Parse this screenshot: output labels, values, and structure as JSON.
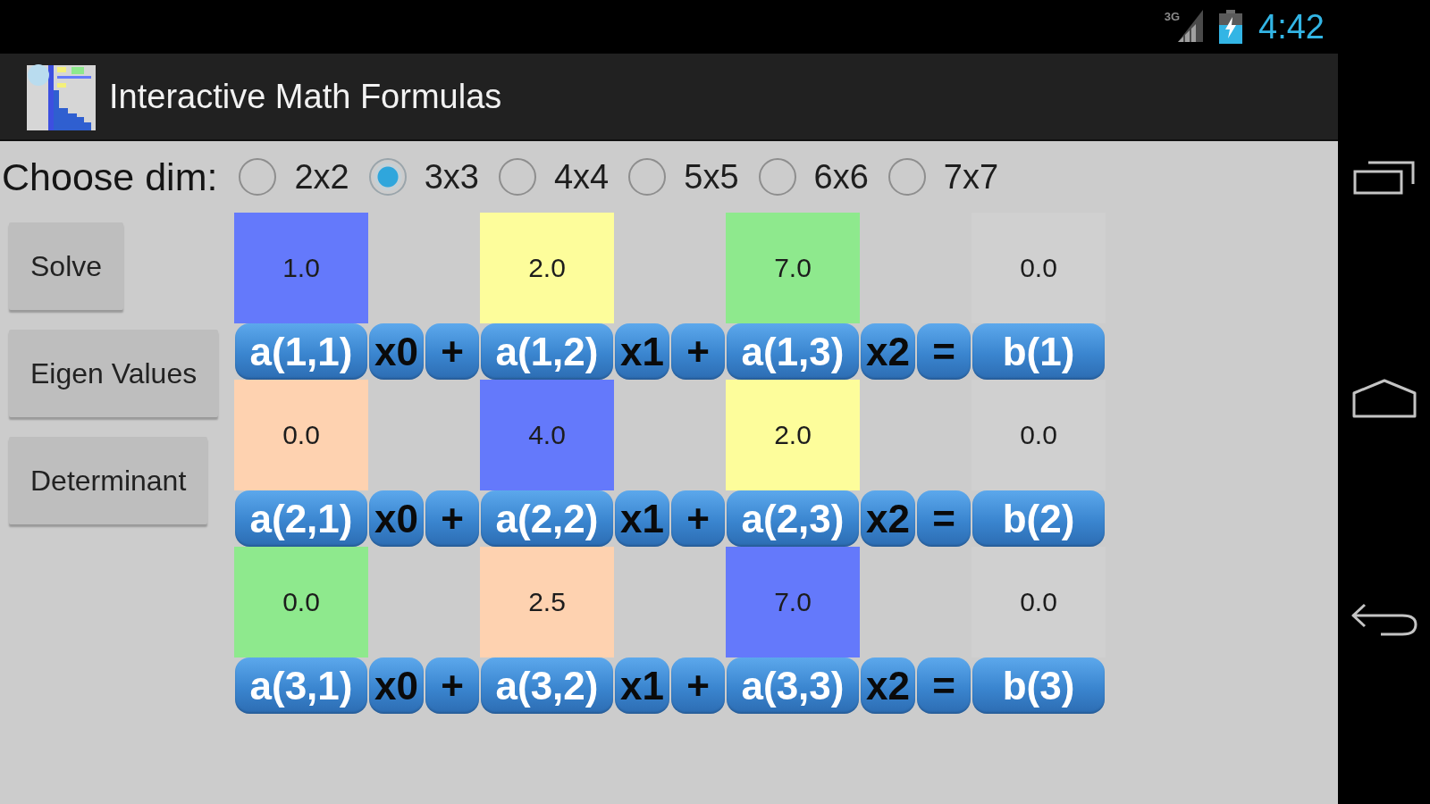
{
  "status_bar": {
    "network": "3G",
    "time": "4:42"
  },
  "app_bar": {
    "title": "Interactive Math Formulas"
  },
  "dimension_picker": {
    "label": "Choose dim:",
    "options": [
      {
        "label": "2x2",
        "selected": false
      },
      {
        "label": "3x3",
        "selected": true
      },
      {
        "label": "4x4",
        "selected": false
      },
      {
        "label": "5x5",
        "selected": false
      },
      {
        "label": "6x6",
        "selected": false
      },
      {
        "label": "7x7",
        "selected": false
      }
    ]
  },
  "actions": [
    "Solve",
    "Eigen Values",
    "Determinant"
  ],
  "equations": [
    {
      "coefficients": [
        {
          "value": "1.0",
          "color": "#6479fb"
        },
        {
          "value": "2.0",
          "color": "#fdfd9b"
        },
        {
          "value": "7.0",
          "color": "#8ee98d"
        }
      ],
      "b_value": "0.0",
      "terms": [
        {
          "label": "a(1,1)",
          "kind": "coefficient"
        },
        {
          "label": "x0",
          "kind": "variable"
        },
        {
          "label": "+",
          "kind": "operator"
        },
        {
          "label": "a(1,2)",
          "kind": "coefficient"
        },
        {
          "label": "x1",
          "kind": "variable"
        },
        {
          "label": "+",
          "kind": "operator"
        },
        {
          "label": "a(1,3)",
          "kind": "coefficient"
        },
        {
          "label": "x2",
          "kind": "variable"
        },
        {
          "label": "=",
          "kind": "operator"
        },
        {
          "label": "b(1)",
          "kind": "constant"
        }
      ]
    },
    {
      "coefficients": [
        {
          "value": "0.0",
          "color": "#fed2b0"
        },
        {
          "value": "4.0",
          "color": "#6479fb"
        },
        {
          "value": "2.0",
          "color": "#fdfd9b"
        }
      ],
      "b_value": "0.0",
      "terms": [
        {
          "label": "a(2,1)",
          "kind": "coefficient"
        },
        {
          "label": "x0",
          "kind": "variable"
        },
        {
          "label": "+",
          "kind": "operator"
        },
        {
          "label": "a(2,2)",
          "kind": "coefficient"
        },
        {
          "label": "x1",
          "kind": "variable"
        },
        {
          "label": "+",
          "kind": "operator"
        },
        {
          "label": "a(2,3)",
          "kind": "coefficient"
        },
        {
          "label": "x2",
          "kind": "variable"
        },
        {
          "label": "=",
          "kind": "operator"
        },
        {
          "label": "b(2)",
          "kind": "constant"
        }
      ]
    },
    {
      "coefficients": [
        {
          "value": "0.0",
          "color": "#8ee98d"
        },
        {
          "value": "2.5",
          "color": "#fed2b0"
        },
        {
          "value": "7.0",
          "color": "#6479fb"
        }
      ],
      "b_value": "0.0",
      "terms": [
        {
          "label": "a(3,1)",
          "kind": "coefficient"
        },
        {
          "label": "x0",
          "kind": "variable"
        },
        {
          "label": "+",
          "kind": "operator"
        },
        {
          "label": "a(3,2)",
          "kind": "coefficient"
        },
        {
          "label": "x1",
          "kind": "variable"
        },
        {
          "label": "+",
          "kind": "operator"
        },
        {
          "label": "a(3,3)",
          "kind": "coefficient"
        },
        {
          "label": "x2",
          "kind": "variable"
        },
        {
          "label": "=",
          "kind": "operator"
        },
        {
          "label": "b(3)",
          "kind": "constant"
        }
      ]
    }
  ]
}
